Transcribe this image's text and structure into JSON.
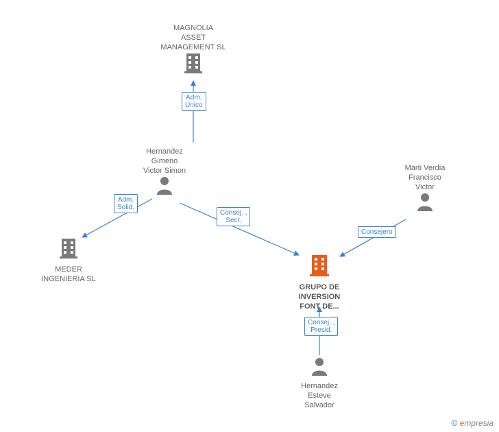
{
  "nodes": {
    "magnolia": {
      "label": "MAGNOLIA\nASSET\nMANAGEMENT SL",
      "type": "company"
    },
    "meder": {
      "label": "MEDER\nINGENIERIA SL",
      "type": "company"
    },
    "grupo": {
      "label": "GRUPO DE\nINVERSION\nFONT DE...",
      "type": "company-main"
    },
    "hernandez_gimeno": {
      "label": "Hernandez\nGimeno\nVictor Simon",
      "type": "person"
    },
    "marti_verdia": {
      "label": "Marti Verdia\nFrancisco\nVictor",
      "type": "person"
    },
    "hernandez_esteve": {
      "label": "Hernandez\nEsteve\nSalvador",
      "type": "person"
    }
  },
  "edges": {
    "adm_unico": {
      "label": "Adm.\nUnico",
      "from": "hernandez_gimeno",
      "to": "magnolia"
    },
    "adm_solid": {
      "label": "Adm.\nSolid.",
      "from": "hernandez_gimeno",
      "to": "meder"
    },
    "consej_secr": {
      "label": "Consej. ,\nSecr.",
      "from": "hernandez_gimeno",
      "to": "grupo"
    },
    "consejero": {
      "label": "Consejero",
      "from": "marti_verdia",
      "to": "grupo"
    },
    "consej_presid": {
      "label": "Consej. ,\nPresid.",
      "from": "hernandez_esteve",
      "to": "grupo"
    }
  },
  "colors": {
    "edge": "#3a7fd5",
    "icon_company": "#7a7a7a",
    "icon_company_main": "#e85d1a",
    "icon_person": "#7a7a7a"
  },
  "watermark": {
    "copyright": "©",
    "brand_initial": "e",
    "brand_rest": "mpresia"
  }
}
